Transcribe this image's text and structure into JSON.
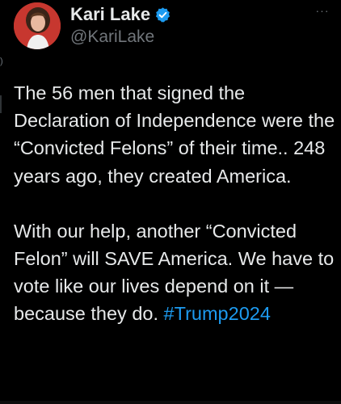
{
  "author": {
    "display_name": "Kari Lake",
    "handle": "@KariLake",
    "verified": true
  },
  "post": {
    "paragraph_1": "The 56 men that signed the Declaration of Independence were the “Convicted Felons” of their time.. 248 years ago, they created America.",
    "paragraph_2": "With our help, another “Convicted Felon” will SAVE America. We have to vote like our lives depend on it — because they do.",
    "hashtag": "#Trump2024"
  },
  "more_menu_label": "···",
  "colors": {
    "background": "#000000",
    "text": "#e7e9ea",
    "muted": "#71767b",
    "link": "#1d9bf0",
    "verified_badge": "#1d9bf0",
    "avatar_background": "#c7372f"
  },
  "icons": {
    "verified": "verified-badge-icon",
    "more": "more-options-icon"
  }
}
